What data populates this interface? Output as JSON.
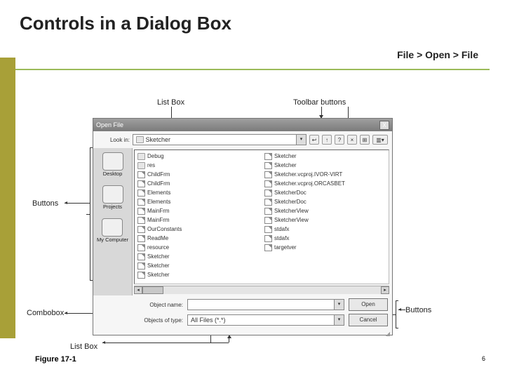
{
  "title": "Controls in a Dialog Box",
  "breadcrumb": "File > Open > File",
  "figure_caption": "Figure 17-1",
  "page_number": "6",
  "annotations": {
    "listbox_top": "List Box",
    "toolbar_buttons": "Toolbar buttons",
    "buttons_left": "Buttons",
    "combobox": "Combobox",
    "listbox_bottom": "List Box",
    "buttons_right": "Buttons"
  },
  "dialog": {
    "title": "Open File",
    "close": "X",
    "lookin_label": "Look in:",
    "lookin_value": "Sketcher",
    "toolbar_icons": [
      "↩",
      "↑",
      "?",
      "×",
      "⊞",
      "▥▾"
    ],
    "places": [
      {
        "label": "Desktop"
      },
      {
        "label": "Projects"
      },
      {
        "label": "My Computer"
      }
    ],
    "files_left": [
      {
        "name": "Debug",
        "type": "folder"
      },
      {
        "name": "res",
        "type": "folder"
      },
      {
        "name": "ChildFrm",
        "type": "file"
      },
      {
        "name": "ChildFrm",
        "type": "file"
      },
      {
        "name": "Elements",
        "type": "file"
      },
      {
        "name": "Elements",
        "type": "file"
      },
      {
        "name": "MainFrm",
        "type": "file"
      },
      {
        "name": "MainFrm",
        "type": "file"
      },
      {
        "name": "OurConstants",
        "type": "file"
      },
      {
        "name": "ReadMe",
        "type": "file"
      },
      {
        "name": "resource",
        "type": "file"
      },
      {
        "name": "Sketcher",
        "type": "file"
      },
      {
        "name": "Sketcher",
        "type": "file"
      },
      {
        "name": "Sketcher",
        "type": "file"
      }
    ],
    "files_right": [
      {
        "name": "Sketcher",
        "type": "file"
      },
      {
        "name": "Sketcher",
        "type": "file"
      },
      {
        "name": "Sketcher.vcproj.IVOR-VIRT",
        "type": "file"
      },
      {
        "name": "Sketcher.vcproj.ORCASBET",
        "type": "file"
      },
      {
        "name": "SketcherDoc",
        "type": "file"
      },
      {
        "name": "SketcherDoc",
        "type": "file"
      },
      {
        "name": "SketcherView",
        "type": "file"
      },
      {
        "name": "SketcherView",
        "type": "file"
      },
      {
        "name": "stdafx",
        "type": "file"
      },
      {
        "name": "stdafx",
        "type": "file"
      },
      {
        "name": "targetver",
        "type": "file"
      }
    ],
    "object_name_label": "Object name:",
    "object_name_value": "",
    "objects_of_type_label": "Objects of type:",
    "objects_of_type_value": "All Files (*.*)",
    "open_btn": "Open",
    "cancel_btn": "Cancel"
  }
}
